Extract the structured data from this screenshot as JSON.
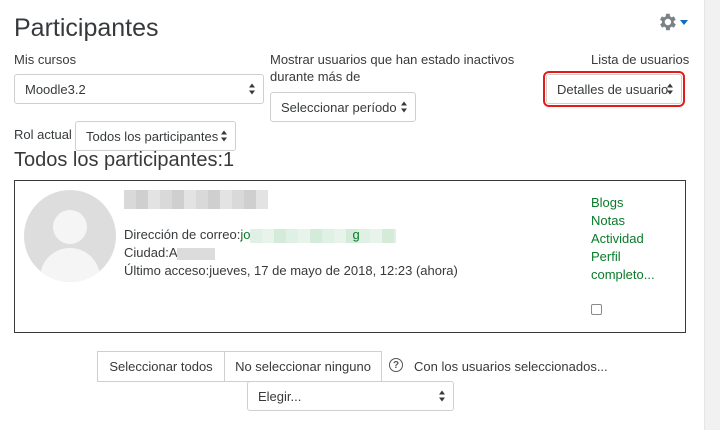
{
  "page": {
    "title": "Participantes"
  },
  "filters": {
    "courses_label": "Mis cursos",
    "courses_value": "Moodle3.2",
    "inactive_label_line1": "Mostrar usuarios que han estado inactivos",
    "inactive_label_line2": "durante más de",
    "inactive_value": "Seleccionar período",
    "list_label": "Lista de usuarios",
    "list_value": "Detalles de usuario",
    "role_label": "Rol actual",
    "role_value": "Todos los participantes"
  },
  "section": {
    "heading": "Todos los participantes:1"
  },
  "user": {
    "email_label": "Dirección de correo:",
    "email_visible": "jo",
    "email_tail": "g",
    "city_label": "Ciudad:",
    "city_visible": "A",
    "last_access_label": "Último acceso:",
    "last_access_value": "jueves, 17 de mayo de 2018, 12:23  (ahora)",
    "links": {
      "blogs": "Blogs",
      "notas": "Notas",
      "actividad": "Actividad",
      "perfil": "Perfil",
      "completo": "completo..."
    }
  },
  "actions": {
    "select_all": "Seleccionar todos",
    "deselect_all": "No seleccionar ninguno",
    "with_selected": "Con los usuarios seleccionados...",
    "choose_value": "Elegir...",
    "help_glyph": "?"
  },
  "icons": {
    "settings": "gear-icon",
    "help": "question-circle-icon"
  },
  "colors": {
    "link_green": "#0a7a2a",
    "highlight_red": "#e41b1b",
    "accent_blue": "#0f6cbf"
  }
}
